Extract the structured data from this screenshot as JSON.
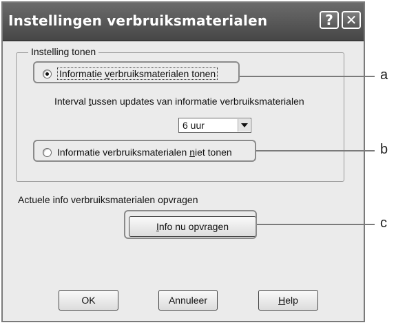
{
  "dialog": {
    "title": "Instellingen verbruiksmaterialen",
    "help_glyph": "?",
    "close_glyph": "✕"
  },
  "group": {
    "legend": "Instelling tonen",
    "option_show": {
      "prefix": "Informatie ",
      "accel": "v",
      "suffix": "erbruiksmaterialen tonen",
      "checked": true
    },
    "interval_label": {
      "prefix": "Interval ",
      "accel": "t",
      "suffix": "ussen updates van informatie verbruiksmaterialen"
    },
    "interval_select": {
      "value": "6 uur"
    },
    "option_hide": {
      "prefix": "Informatie verbruiksmaterialen ",
      "accel": "n",
      "suffix": "iet tonen",
      "checked": false
    }
  },
  "request": {
    "label": "Actuele info verbruiksmaterialen opvragen",
    "button": {
      "accel": "I",
      "suffix": "nfo nu opvragen"
    }
  },
  "buttons": {
    "ok": "OK",
    "cancel": "Annuleer",
    "help": {
      "accel": "H",
      "suffix": "elp"
    }
  },
  "callouts": {
    "a": "a",
    "b": "b",
    "c": "c"
  }
}
